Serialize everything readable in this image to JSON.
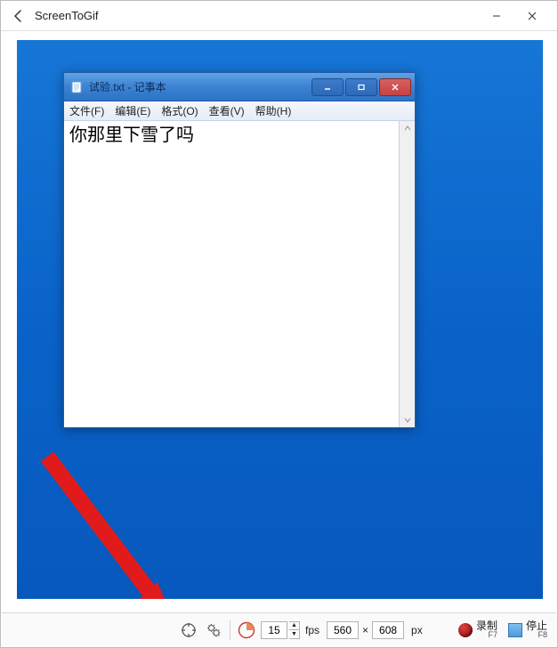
{
  "stg": {
    "title": "ScreenToGif",
    "bottom": {
      "fps_value": "15",
      "fps_label": "fps",
      "width": "560",
      "height": "608",
      "px_label": "px",
      "record_label": "录制",
      "record_key": "F7",
      "stop_label": "停止",
      "stop_key": "F8"
    }
  },
  "notepad": {
    "title": "试验.txt - 记事本",
    "menus": {
      "file": "文件(F)",
      "edit": "编辑(E)",
      "format": "格式(O)",
      "view": "查看(V)",
      "help": "帮助(H)"
    },
    "content": "你那里下雪了吗"
  }
}
